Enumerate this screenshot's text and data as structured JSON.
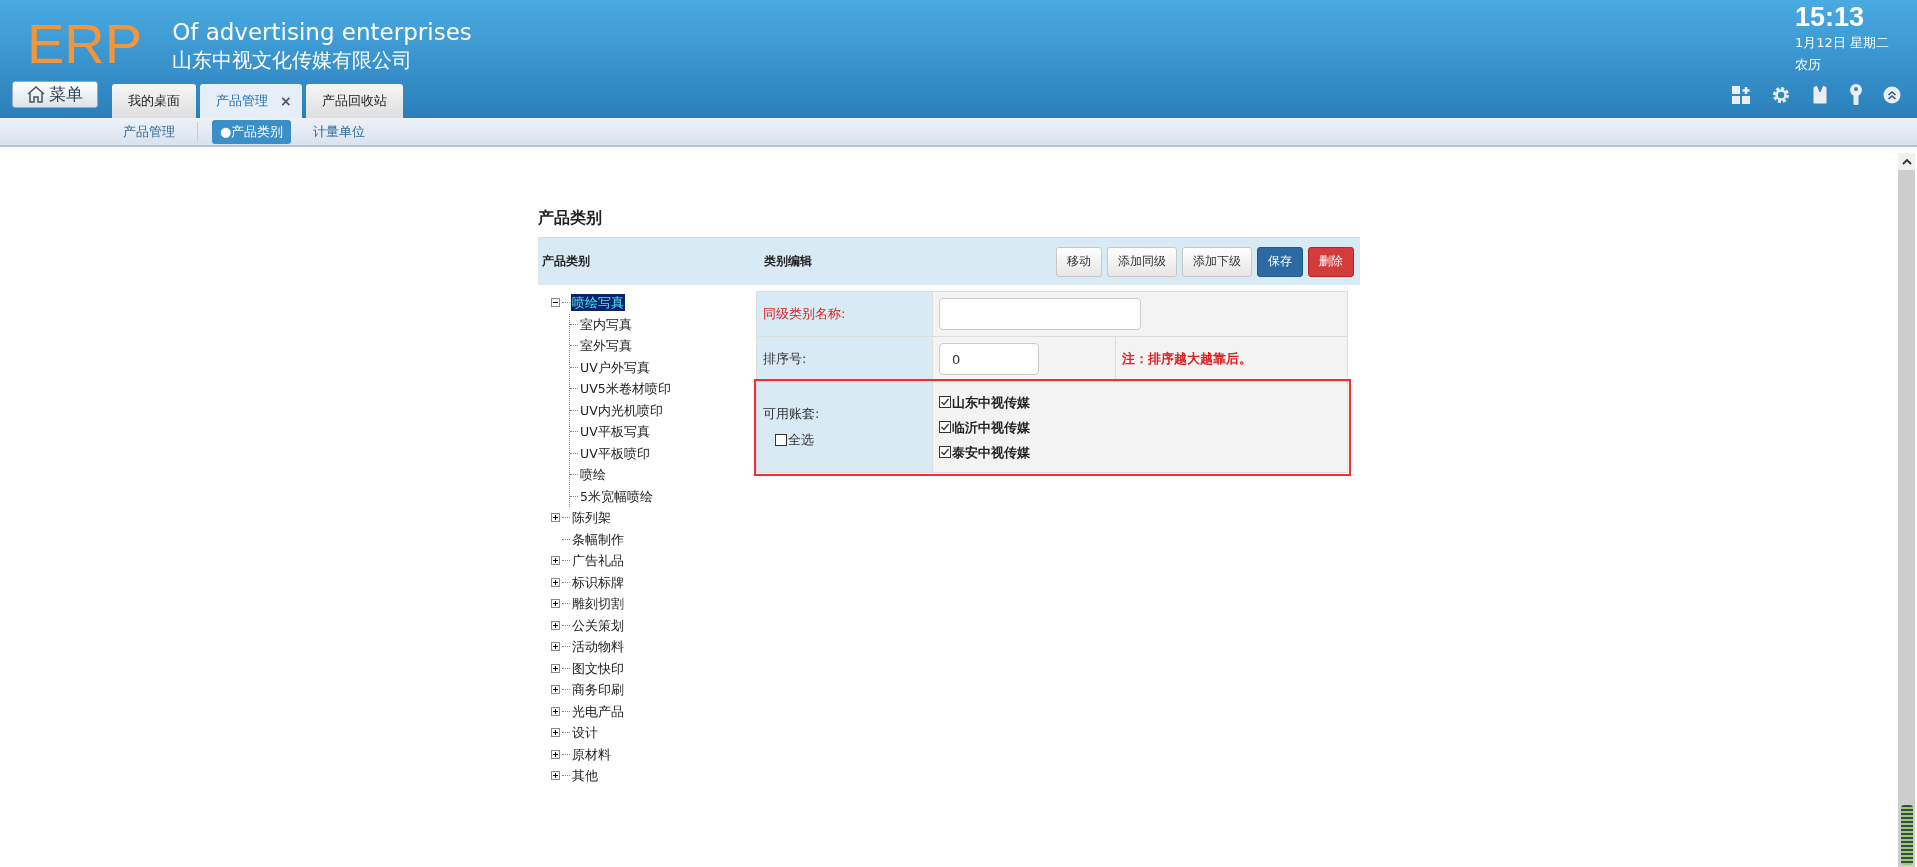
{
  "header": {
    "logo": "ERP",
    "title": "Of advertising enterprises",
    "company": "山东中视文化传媒有限公司",
    "menu_button": "菜单",
    "clock": {
      "time": "15:13",
      "date": "1月12日 星期二",
      "lunar": "农历"
    }
  },
  "tabs": [
    {
      "label": "我的桌面",
      "selected": false
    },
    {
      "label": "产品管理",
      "selected": true,
      "close": "×"
    },
    {
      "label": "产品回收站",
      "selected": false
    }
  ],
  "subnav": [
    {
      "label": "产品管理",
      "selected": false
    },
    {
      "label": "●产品类别",
      "selected": true
    },
    {
      "label": "计量单位",
      "selected": false
    }
  ],
  "page_title": "产品类别",
  "panel": {
    "tree_heading": "产品类别",
    "edit_heading": "类别编辑",
    "buttons": [
      {
        "label": "移动",
        "kind": "default"
      },
      {
        "label": "添加同级",
        "kind": "default"
      },
      {
        "label": "添加下级",
        "kind": "default"
      },
      {
        "label": "保存",
        "kind": "primary"
      },
      {
        "label": "删除",
        "kind": "danger"
      }
    ]
  },
  "tree": [
    {
      "label": "喷绘写真",
      "selected": true,
      "expanded": true,
      "children": [
        {
          "label": "室内写真",
          "selected": false
        },
        {
          "label": "室外写真",
          "selected": false
        },
        {
          "label": "UV户外写真",
          "selected": false
        },
        {
          "label": "UV5米卷材喷印",
          "selected": false
        },
        {
          "label": "UV内光机喷印",
          "selected": false
        },
        {
          "label": "UV平板写真",
          "selected": false
        },
        {
          "label": "UV平板喷印",
          "selected": false
        },
        {
          "label": "喷绘",
          "selected": false
        },
        {
          "label": "5米宽幅喷绘",
          "selected": false
        }
      ]
    },
    {
      "label": "陈列架",
      "selected": false,
      "expanded": false
    },
    {
      "label": "条幅制作",
      "selected": false
    },
    {
      "label": "广告礼品",
      "selected": false,
      "expanded": false
    },
    {
      "label": "标识标牌",
      "selected": false,
      "expanded": false
    },
    {
      "label": "雕刻切割",
      "selected": false,
      "expanded": false
    },
    {
      "label": "公关策划",
      "selected": false,
      "expanded": false
    },
    {
      "label": "活动物料",
      "selected": false,
      "expanded": false
    },
    {
      "label": "图文快印",
      "selected": false,
      "expanded": false
    },
    {
      "label": "商务印刷",
      "selected": false,
      "expanded": false
    },
    {
      "label": "光电产品",
      "selected": false,
      "expanded": false
    },
    {
      "label": "设计",
      "selected": false,
      "expanded": false
    },
    {
      "label": "原材料",
      "selected": false,
      "expanded": false
    },
    {
      "label": "其他",
      "selected": false,
      "expanded": false
    }
  ],
  "form": [
    {
      "kind": "text",
      "label": "同级类别名称:",
      "required": true,
      "highlighted": false
    },
    {
      "kind": "number",
      "label": "排序号:",
      "value": "0",
      "note": "注：排序越大越靠后。",
      "required": false,
      "highlighted": false
    },
    {
      "kind": "accounts",
      "label": "可用账套:",
      "select_all": {
        "label": "全选",
        "checked": false
      },
      "required": false,
      "highlighted": true,
      "options": [
        {
          "label": "山东中视传媒",
          "checked": true
        },
        {
          "label": "临沂中视传媒",
          "checked": true
        },
        {
          "label": "泰安中视传媒",
          "checked": true
        }
      ]
    }
  ]
}
